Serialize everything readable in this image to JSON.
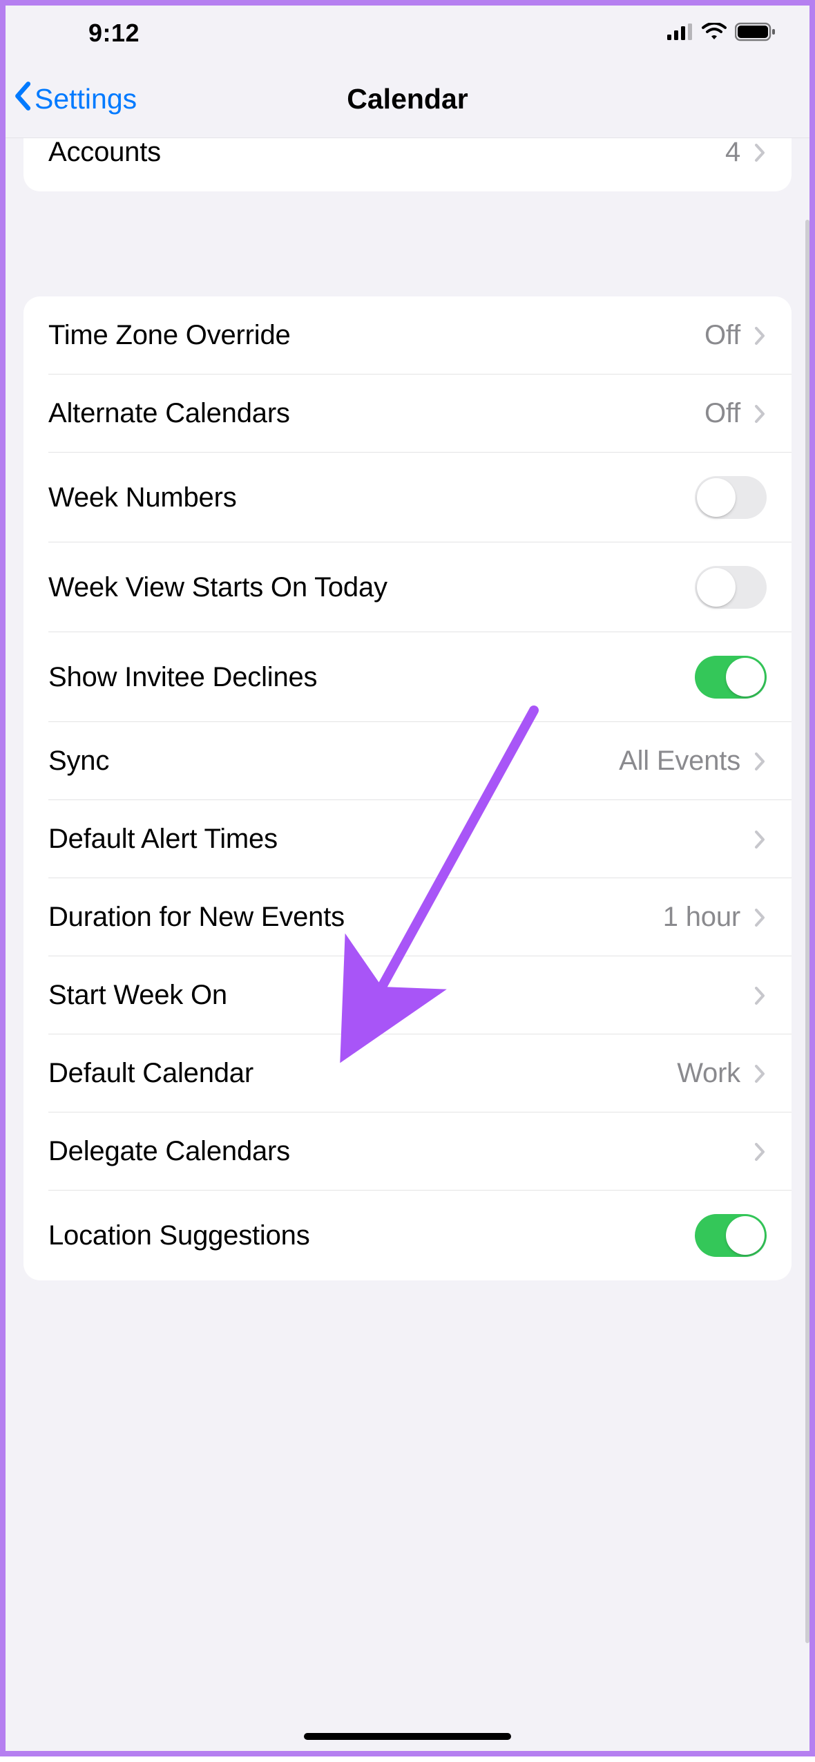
{
  "status": {
    "time": "9:12"
  },
  "nav": {
    "back_label": "Settings",
    "title": "Calendar"
  },
  "section_top": {
    "accounts": {
      "label": "Accounts",
      "value": "4"
    }
  },
  "settings": {
    "time_zone_override": {
      "label": "Time Zone Override",
      "value": "Off"
    },
    "alternate_calendars": {
      "label": "Alternate Calendars",
      "value": "Off"
    },
    "week_numbers": {
      "label": "Week Numbers",
      "on": false
    },
    "week_view_starts_today": {
      "label": "Week View Starts On Today",
      "on": false
    },
    "show_invitee_declines": {
      "label": "Show Invitee Declines",
      "on": true
    },
    "sync": {
      "label": "Sync",
      "value": "All Events"
    },
    "default_alert_times": {
      "label": "Default Alert Times"
    },
    "duration_new_events": {
      "label": "Duration for New Events",
      "value": "1 hour"
    },
    "start_week_on": {
      "label": "Start Week On"
    },
    "default_calendar": {
      "label": "Default Calendar",
      "value": "Work"
    },
    "delegate_calendars": {
      "label": "Delegate Calendars"
    },
    "location_suggestions": {
      "label": "Location Suggestions",
      "on": true
    }
  },
  "annotation": {
    "target": "default_alert_times",
    "color": "#a855f7"
  }
}
